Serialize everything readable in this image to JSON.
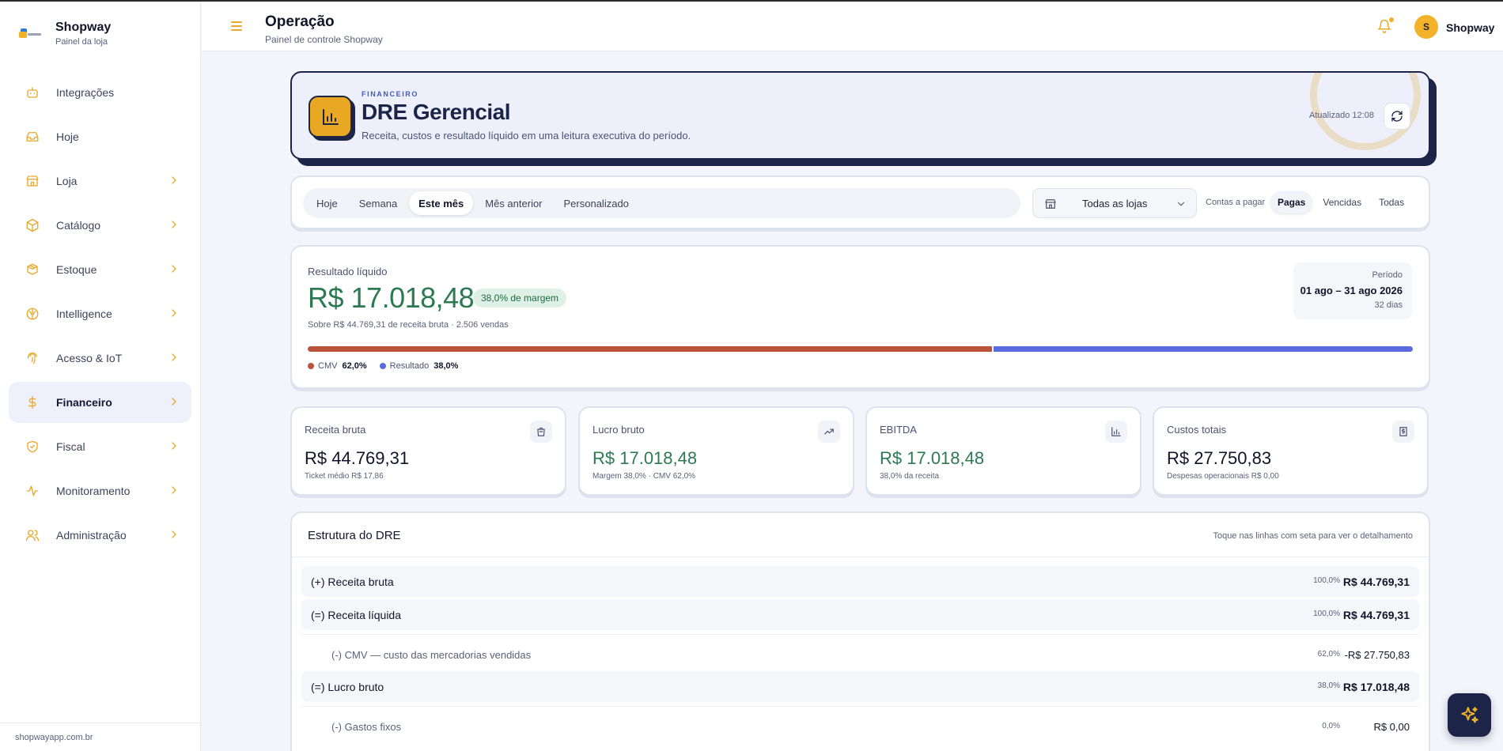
{
  "brand": {
    "title": "Shopway",
    "subtitle": "Painel da loja"
  },
  "sidebar": {
    "items": [
      {
        "label": "Integrações",
        "icon": "bot-icon",
        "has_chevron": false,
        "active": false
      },
      {
        "label": "Hoje",
        "icon": "inbox-icon",
        "has_chevron": false,
        "active": false
      },
      {
        "label": "Loja",
        "icon": "store-icon",
        "has_chevron": true,
        "active": false
      },
      {
        "label": "Catálogo",
        "icon": "package-icon",
        "has_chevron": true,
        "active": false
      },
      {
        "label": "Estoque",
        "icon": "boxes-icon",
        "has_chevron": true,
        "active": false
      },
      {
        "label": "Intelligence",
        "icon": "brain-icon",
        "has_chevron": true,
        "active": false
      },
      {
        "label": "Acesso & IoT",
        "icon": "fingerprint-icon",
        "has_chevron": true,
        "active": false
      },
      {
        "label": "Financeiro",
        "icon": "dollar-icon",
        "has_chevron": true,
        "active": true
      },
      {
        "label": "Fiscal",
        "icon": "shield-check-icon",
        "has_chevron": true,
        "active": false
      },
      {
        "label": "Monitoramento",
        "icon": "activity-icon",
        "has_chevron": true,
        "active": false
      },
      {
        "label": "Administração",
        "icon": "users-icon",
        "has_chevron": true,
        "active": false
      }
    ],
    "footer": "shopwayapp.com.br"
  },
  "header": {
    "title": "Operação",
    "subtitle": "Painel de controle Shopway",
    "user_initial": "S",
    "user_name": "Shopway"
  },
  "hero": {
    "kicker": "FINANCEIRO",
    "title": "DRE Gerencial",
    "subtitle": "Receita, custos e resultado líquido em uma leitura executiva do período.",
    "updated": "Atualizado 12:08"
  },
  "filters": {
    "periods": [
      "Hoje",
      "Semana",
      "Este mês",
      "Mês anterior",
      "Personalizado"
    ],
    "active_period": 2,
    "store_select": "Todas as lojas",
    "payables_label": "Contas a pagar",
    "payables": [
      "Pagas",
      "Vencidas",
      "Todas"
    ],
    "active_payable": 0
  },
  "result": {
    "label": "Resultado líquido",
    "value": "R$ 17.018,48",
    "margin_badge": "38,0% de margem",
    "note": "Sobre R$ 44.769,31 de receita bruta · 2.506 vendas",
    "period_label": "Período",
    "period_range": "01 ago – 31 ago 2026",
    "period_days": "32 dias",
    "bar": [
      {
        "name": "CMV",
        "value_label": "62,0%",
        "fraction": 0.62,
        "color": "#b9533a"
      },
      {
        "name": "Resultado",
        "value_label": "38,0%",
        "fraction": 0.38,
        "color": "#5a6be0"
      }
    ]
  },
  "kpis": [
    {
      "label": "Receita bruta",
      "value": "R$ 44.769,31",
      "note": "Ticket médio R$ 17,86",
      "icon": "shopping-bag-icon",
      "green": false
    },
    {
      "label": "Lucro bruto",
      "value": "R$ 17.018,48",
      "note": "Margem 38,0% · CMV 62,0%",
      "icon": "trending-up-icon",
      "green": true
    },
    {
      "label": "EBITDA",
      "value": "R$ 17.018,48",
      "note": "38,0% da receita",
      "icon": "bar-chart-icon",
      "green": true
    },
    {
      "label": "Custos totais",
      "value": "R$ 27.750,83",
      "note": "Despesas operacionais R$ 0,00",
      "icon": "receipt-icon",
      "green": false
    }
  ],
  "dre": {
    "title": "Estrutura do DRE",
    "hint": "Toque nas linhas com seta para ver o detalhamento",
    "rows": [
      {
        "label": "(+) Receita bruta",
        "pct": "100,0%",
        "value": "R$ 44.769,31",
        "type": "main"
      },
      {
        "label": "(=) Receita líquida",
        "pct": "100,0%",
        "value": "R$ 44.769,31",
        "type": "main"
      },
      {
        "label": "(-) CMV — custo das mercadorias vendidas",
        "pct": "62,0%",
        "value": "-R$ 27.750,83",
        "type": "sub"
      },
      {
        "label": "(=) Lucro bruto",
        "pct": "38,0%",
        "value": "R$ 17.018,48",
        "type": "main"
      },
      {
        "label": "(-) Gastos fixos",
        "pct": "0,0%",
        "value": "R$ 0,00",
        "type": "sub"
      }
    ]
  }
}
